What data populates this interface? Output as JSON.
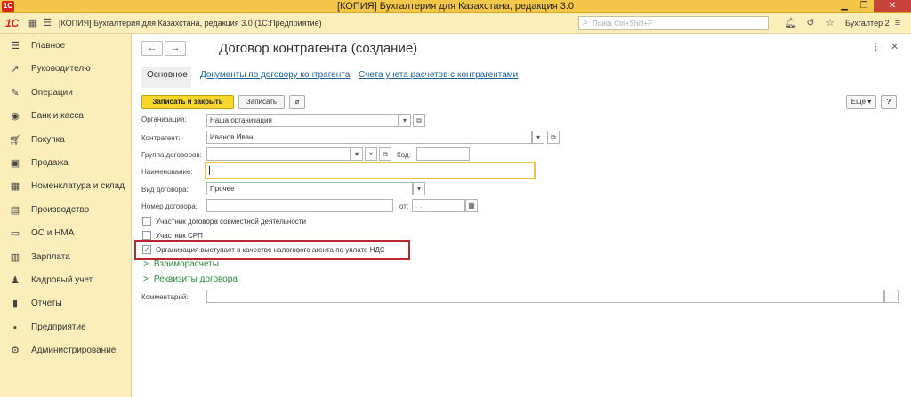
{
  "window": {
    "title": "[КОПИЯ] Бухгалтерия для Казахстана, редакция 3.0",
    "db_title": "[КОПИЯ] Бухгалтерия для Казахстана, редакция 3.0  (1С:Предприятие)",
    "search_placeholder": "Поиск Ctrl+Shift+F",
    "user": "Бухгалтер 2",
    "logo": "1С"
  },
  "sidebar": {
    "items": [
      {
        "label": "Главное",
        "icon": "menu-icon"
      },
      {
        "label": "Руководителю",
        "icon": "chart-icon"
      },
      {
        "label": "Операции",
        "icon": "operations-icon"
      },
      {
        "label": "Банк и касса",
        "icon": "bank-icon"
      },
      {
        "label": "Покупка",
        "icon": "cart-icon"
      },
      {
        "label": "Продажа",
        "icon": "bag-icon"
      },
      {
        "label": "Номенклатура и склад",
        "icon": "warehouse-icon"
      },
      {
        "label": "Производство",
        "icon": "factory-icon"
      },
      {
        "label": "ОС и НМА",
        "icon": "truck-icon"
      },
      {
        "label": "Зарплата",
        "icon": "salary-icon"
      },
      {
        "label": "Кадровый учет",
        "icon": "people-icon"
      },
      {
        "label": "Отчеты",
        "icon": "reports-icon"
      },
      {
        "label": "Предприятие",
        "icon": "enterprise-icon"
      },
      {
        "label": "Администрирование",
        "icon": "gear-icon"
      }
    ]
  },
  "form": {
    "title": "Договор контрагента (создание)",
    "tabs": [
      "Основное",
      "Документы по договору контрагента",
      "Счета учета расчетов с контрагентами"
    ],
    "buttons": {
      "save_close": "Записать и закрыть",
      "save": "Записать",
      "more": "Еще",
      "help": "?"
    },
    "fields": {
      "organization": {
        "label": "Организация:",
        "value": "Наша организация"
      },
      "counterparty": {
        "label": "Контрагент:",
        "value": "Иванов Иван"
      },
      "contract_group": {
        "label": "Группа договоров:",
        "value": ""
      },
      "code": {
        "label": "Код:",
        "value": ""
      },
      "name": {
        "label": "Наименование:",
        "value": ""
      },
      "contract_type": {
        "label": "Вид договора:",
        "value": "Прочее"
      },
      "contract_number": {
        "label": "Номер договора:",
        "value": ""
      },
      "date_from": {
        "label": "от:",
        "value": " .  ."
      },
      "comment": {
        "label": "Комментарий:",
        "value": ""
      }
    },
    "checkboxes": [
      {
        "label": "Участник договора совместной деятельности",
        "checked": false
      },
      {
        "label": "Участник СРП",
        "checked": false
      },
      {
        "label": "Организация выступает в качестве налогового агента по уплате НДС",
        "checked": true
      }
    ],
    "groups": [
      "Взаиморасчеты",
      "Реквизиты договора"
    ]
  },
  "colors": {
    "accent": "#f6d72a",
    "brand": "#d7261e",
    "sidebar_bg": "#fbeebb",
    "link": "#1a5e9a",
    "group": "#2b8a3e",
    "highlight": "#b8262e"
  }
}
